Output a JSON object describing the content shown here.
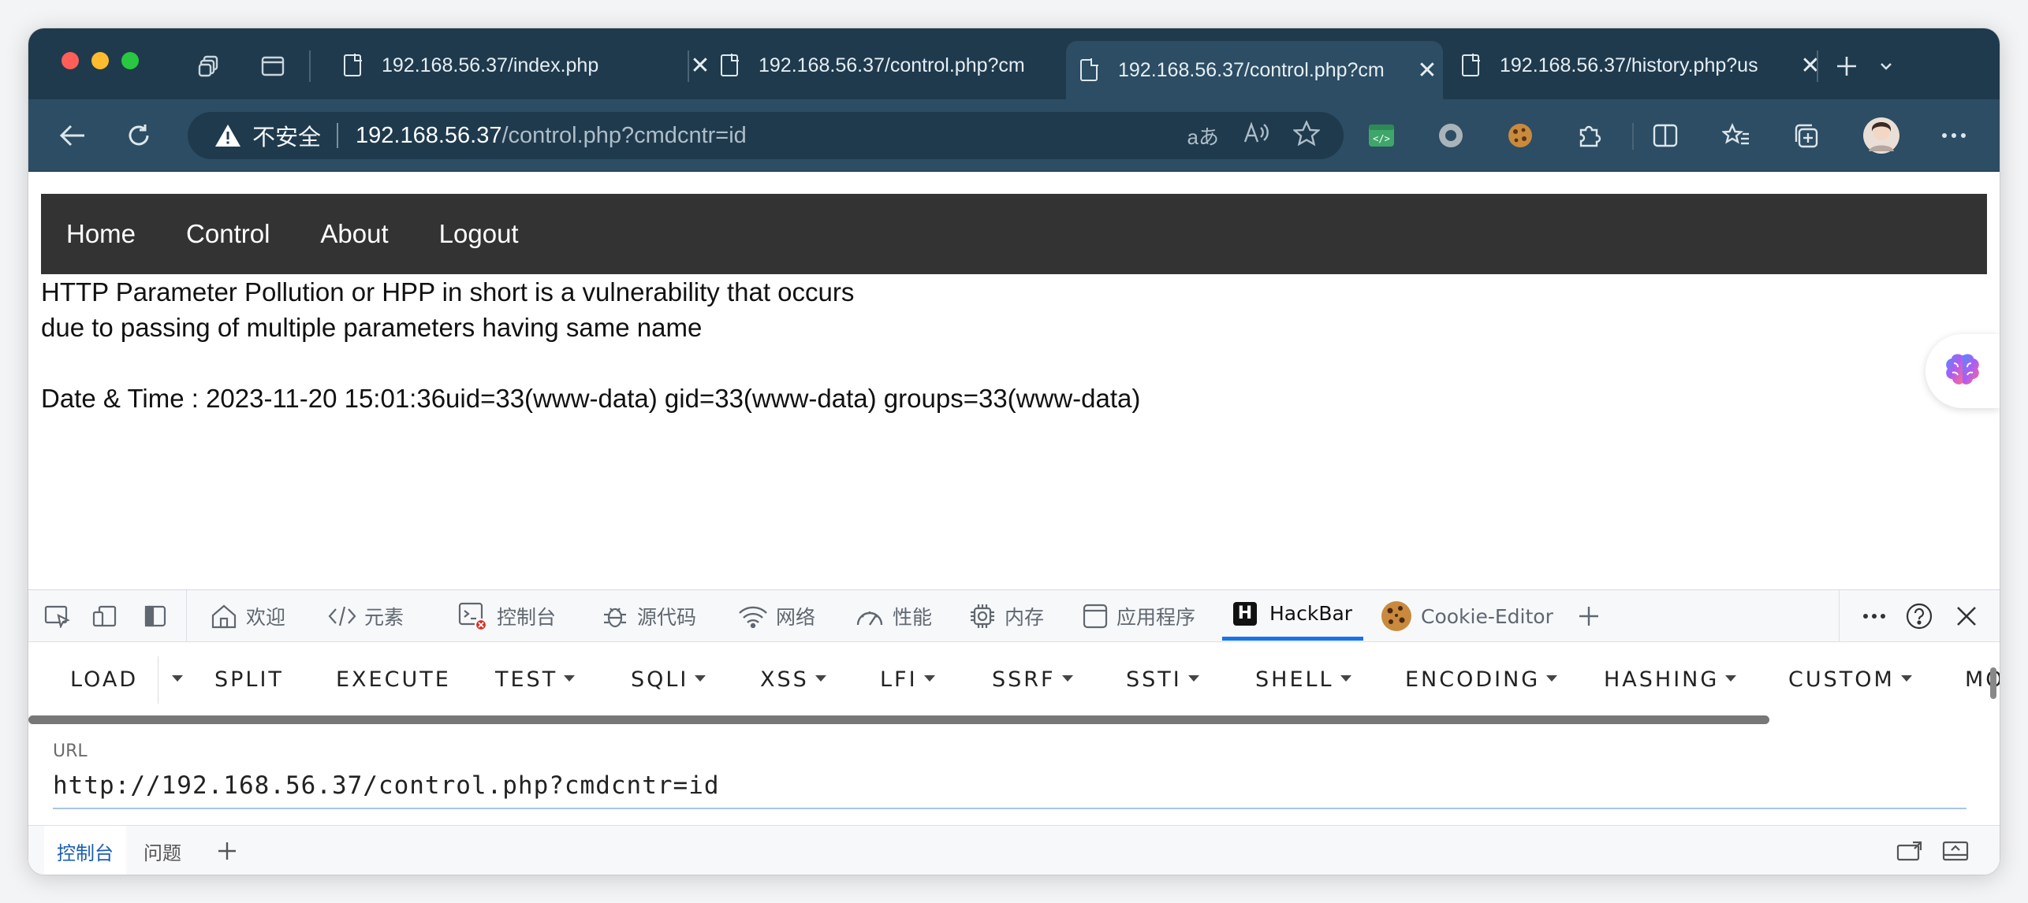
{
  "colors": {
    "tabbar": "#1f3a4d",
    "toolbar": "#2c4d63",
    "nav_bg": "#333333",
    "accent": "#1a73e8"
  },
  "tabs": [
    {
      "title": "192.168.56.37/index.php",
      "active": false
    },
    {
      "title": "192.168.56.37/control.php?cm",
      "active": false
    },
    {
      "title": "192.168.56.37/control.php?cm",
      "active": true
    },
    {
      "title": "192.168.56.37/history.php?us",
      "active": false
    }
  ],
  "address": {
    "security_label": "不安全",
    "host": "192.168.56.37",
    "path": "/control.php?cmdcntr=id",
    "read_aloud_label": "aあ"
  },
  "page": {
    "nav": [
      "Home",
      "Control",
      "About",
      "Logout"
    ],
    "line1": "HTTP Parameter Pollution or HPP in short is a vulnerability that occurs",
    "line2": "due to passing of multiple parameters having same name",
    "line3": "Date & Time : 2023-11-20 15:01:36uid=33(www-data) gid=33(www-data) groups=33(www-data)"
  },
  "devtools": {
    "tabs": {
      "welcome": "欢迎",
      "elements": "元素",
      "console": "控制台",
      "sources": "源代码",
      "network": "网络",
      "performance": "性能",
      "memory": "内存",
      "application": "应用程序",
      "hackbar": "HackBar",
      "cookie_editor": "Cookie-Editor"
    },
    "hackbar_menu": {
      "load": "LOAD",
      "split": "SPLIT",
      "execute": "EXECUTE",
      "test": "TEST",
      "sqli": "SQLI",
      "xss": "XSS",
      "lfi": "LFI",
      "ssrf": "SSRF",
      "ssti": "SSTI",
      "shell": "SHELL",
      "encoding": "ENCODING",
      "hashing": "HASHING",
      "custom": "CUSTOM",
      "more": "MO"
    },
    "url_label": "URL",
    "url_value": "http://192.168.56.37/control.php?cmdcntr=id",
    "drawer_tabs": {
      "console": "控制台",
      "issues": "问题"
    }
  }
}
